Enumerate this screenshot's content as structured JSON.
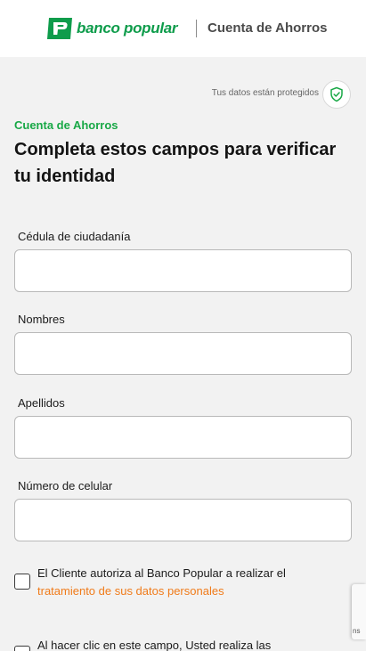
{
  "header": {
    "brand_name": "banco popular",
    "product_name": "Cuenta de Ahorros",
    "brand_color": "#0e9c4b",
    "logo_icon": "banco-popular-logo-icon"
  },
  "security": {
    "protected_text": "Tus datos están protegidos",
    "icon": "shield-check-icon"
  },
  "main": {
    "kicker": "Cuenta de Ahorros",
    "title": "Completa estos campos para verificar tu identidad",
    "accent_color": "#18a846"
  },
  "form": {
    "fields": [
      {
        "label": "Cédula de ciudadanía",
        "value": ""
      },
      {
        "label": "Nombres",
        "value": ""
      },
      {
        "label": "Apellidos",
        "value": ""
      },
      {
        "label": "Número de celular",
        "value": ""
      }
    ],
    "consents": [
      {
        "text": "El Cliente autoriza al Banco Popular a realizar el",
        "link_text": "tratamiento de sus datos personales",
        "checked": false
      },
      {
        "text": "Al hacer clic en este campo, Usted realiza las",
        "checked": false
      }
    ],
    "link_color": "#f07b1a"
  },
  "recaptcha": {
    "partial_text": "ns"
  }
}
